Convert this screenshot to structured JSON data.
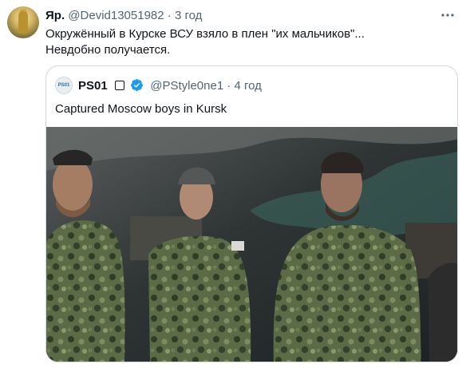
{
  "tweet": {
    "author_name": "Яр.",
    "author_handle": "@Devid13051982",
    "separator": "·",
    "time": "3 год",
    "text_line1": "Окружённый в Курске ВСУ взяло в плен \"их мальчиков\"...",
    "text_line2": "Невдобно получается.",
    "more_icon": "more-icon"
  },
  "quote": {
    "avatar_text": "PS01",
    "author_name": "PS01",
    "author_handle": "@PStyle0ne1",
    "separator": "·",
    "time": "4 год",
    "text": "Captured Moscow boys in Kursk",
    "verified_icon": "verified-badge-icon",
    "accent_color": "#1d9bf0"
  }
}
